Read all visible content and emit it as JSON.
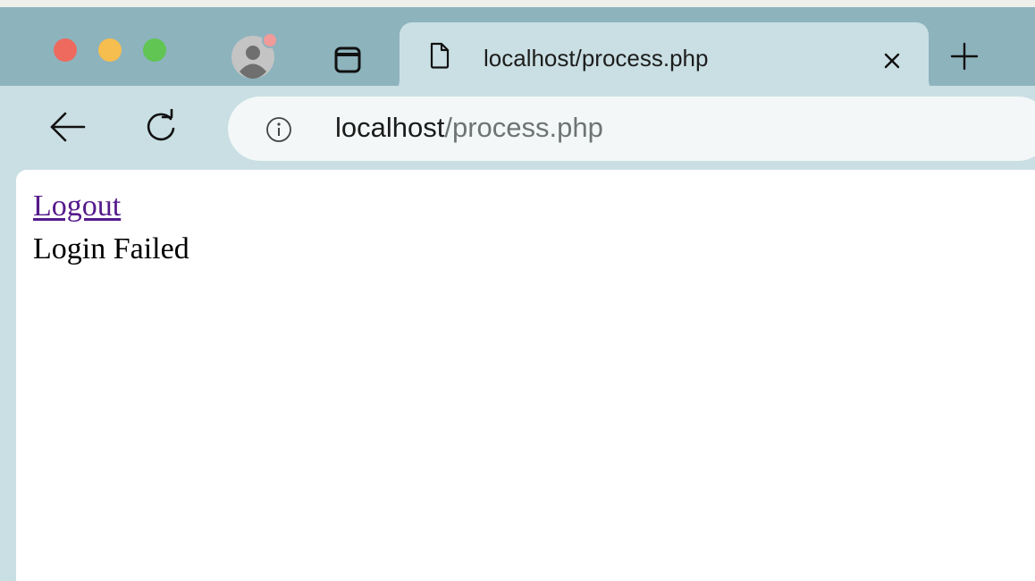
{
  "window": {
    "traffic_lights": [
      "close",
      "minimize",
      "maximize"
    ],
    "colors": {
      "close": "#ee6a5f",
      "minimize": "#f5be4f",
      "maximize": "#61c554",
      "tab_bar": "#8db3bd",
      "toolbar": "#c9dfe3"
    }
  },
  "tabs": {
    "profile_icon": "profile-avatar-icon",
    "tab_view_icon": "tab-overview-icon",
    "active": {
      "title": "localhost/process.php",
      "icon": "document-icon",
      "close_icon": "close-icon"
    },
    "new_tab_icon": "plus-icon"
  },
  "toolbar": {
    "back_icon": "back-arrow-icon",
    "reload_icon": "reload-icon",
    "address": {
      "info_icon": "info-icon",
      "host": "localhost",
      "path": "/process.php"
    }
  },
  "page": {
    "logout_link": "Logout",
    "message": "Login Failed"
  }
}
